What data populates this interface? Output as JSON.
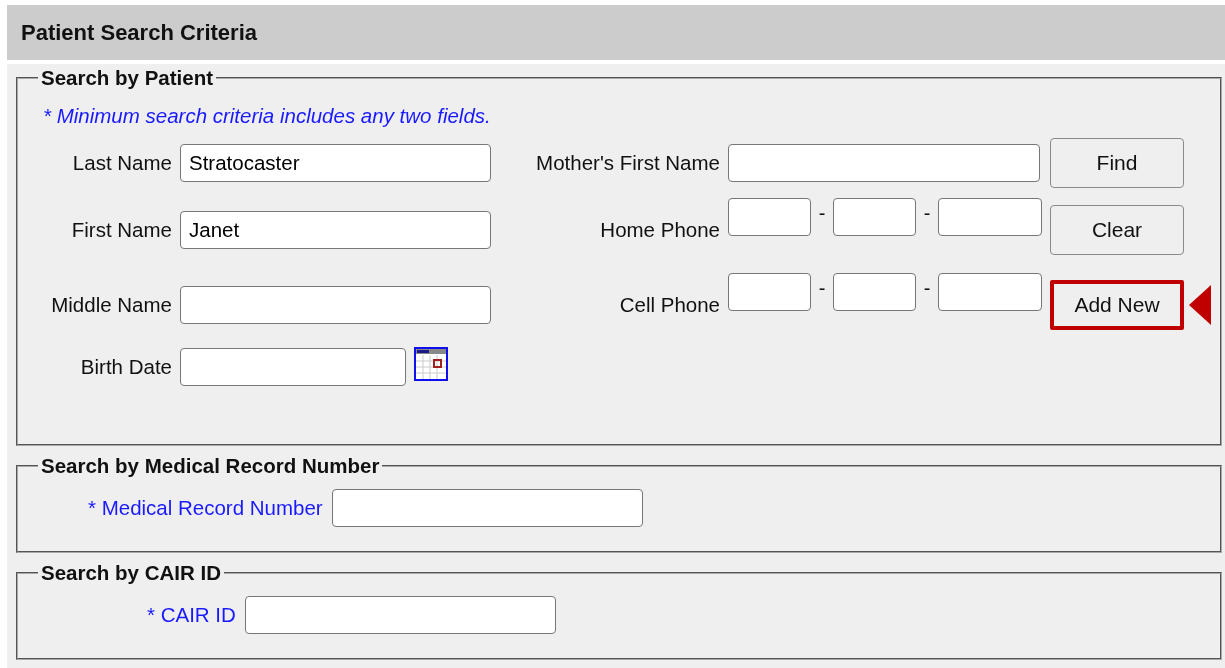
{
  "header": {
    "title": "Patient Search Criteria"
  },
  "patient": {
    "legend": "Search by Patient",
    "note": "* Minimum search criteria includes any two fields.",
    "left_fields": [
      {
        "label": "Last Name",
        "kind": "text",
        "value": "Stratocaster"
      },
      {
        "label": "First Name",
        "kind": "text",
        "value": "Janet"
      },
      {
        "label": "Middle Name",
        "kind": "text"
      },
      {
        "label": "Birth Date",
        "kind": "date"
      }
    ],
    "right_fields": [
      {
        "label": "Mother's First Name",
        "kind": "text"
      },
      {
        "label": "Home Phone",
        "kind": "phone",
        "separators": [
          "-",
          "-"
        ]
      },
      {
        "label": "Cell Phone",
        "kind": "phone",
        "separators": [
          "-",
          "-"
        ]
      }
    ],
    "buttons": [
      {
        "label": "Find",
        "highlighted": false
      },
      {
        "label": "Clear",
        "highlighted": false
      },
      {
        "label": "Add New",
        "highlighted": true
      }
    ]
  },
  "sections": [
    {
      "kind": "mrn",
      "legend": "Search by Medical Record Number",
      "label": "* Medical Record Number"
    },
    {
      "kind": "cair",
      "legend": "Search by CAIR ID",
      "label": "* CAIR ID"
    }
  ]
}
